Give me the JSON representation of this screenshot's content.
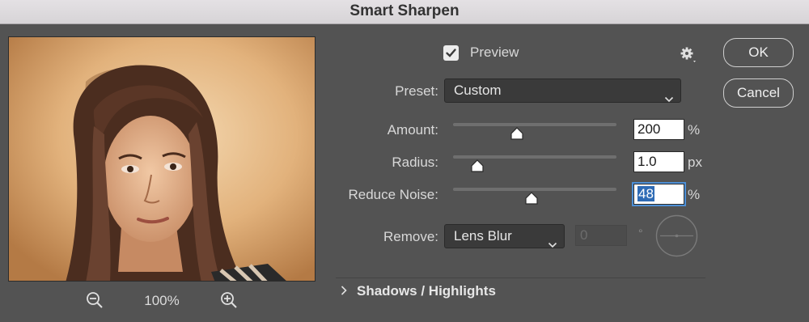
{
  "window": {
    "title": "Smart Sharpen"
  },
  "preview_pane": {
    "zoom_level": "100%",
    "image_description": ""
  },
  "preview_toggle": {
    "label": "Preview",
    "checked": true
  },
  "preset": {
    "label": "Preset:",
    "value": "Custom"
  },
  "amount": {
    "label": "Amount:",
    "value": "200",
    "unit": "%",
    "slider_fraction": 0.39
  },
  "radius": {
    "label": "Radius:",
    "value": "1.0",
    "unit": "px",
    "slider_fraction": 0.15
  },
  "reduce_noise": {
    "label": "Reduce Noise:",
    "value": "48",
    "unit": "%",
    "slider_fraction": 0.48
  },
  "remove": {
    "label": "Remove:",
    "value": "Lens Blur",
    "angle_value": "0",
    "angle_unit": "°"
  },
  "buttons": {
    "ok": "OK",
    "cancel": "Cancel"
  },
  "section": {
    "title": "Shadows / Highlights",
    "expanded": false
  },
  "icons": {
    "zoom_out": "zoom-out-icon",
    "zoom_in": "zoom-in-icon",
    "settings": "gear-icon",
    "dropdown": "chevron-down-icon",
    "section": "chevron-right-icon"
  },
  "colors": {
    "accent": "#2e6bb5",
    "background": "#535353",
    "field_dark": "#3a3a3a"
  }
}
